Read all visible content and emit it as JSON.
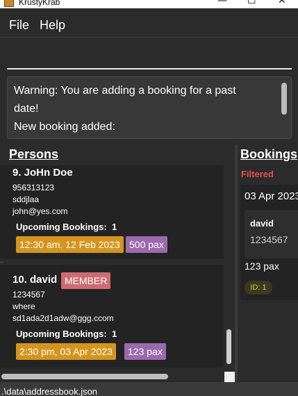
{
  "window": {
    "title": "KrustyKrab",
    "minimize_glyph": "—",
    "maximize_glyph": "☐",
    "close_glyph": "✕"
  },
  "menu": {
    "file": "File",
    "help": "Help"
  },
  "command": {
    "value": ""
  },
  "result": {
    "line1": "Warning: You are adding a booking for a past",
    "line2": "date!",
    "line3": "New booking added:"
  },
  "persons": {
    "heading": "Persons",
    "list": [
      {
        "name": "9. JoHn Doe",
        "phone": "956313123",
        "address": "sddjlaa",
        "email": "john@yes.com",
        "upcoming_label": "Upcoming Bookings:",
        "upcoming_count": "1",
        "booking_time": "12:30 am, 12 Feb 2023",
        "booking_pax": "500 pax"
      },
      {
        "name": "10. david",
        "tag": "MEMBER",
        "phone": "1234567",
        "address": "where",
        "email": "sd1ada2d1adw@ggg.ccom",
        "upcoming_label": "Upcoming Bookings:",
        "upcoming_count": "1",
        "booking_time": "2:30 pm, 03 Apr 2023",
        "booking_pax": "123 pax"
      }
    ]
  },
  "bookings": {
    "heading": "Bookings",
    "filter_label": "Filtered",
    "card": {
      "date": "03 Apr 2023",
      "customer_name": "david",
      "customer_phone": "1234567",
      "pax": "123 pax",
      "id": "ID: 1"
    }
  },
  "status": {
    "path": ".\\data\\addressbook.json"
  },
  "colors": {
    "accent_orange": "#d4951f",
    "accent_purple": "#9a6aab",
    "member_tag": "#cd6b73",
    "filtered": "#e05050",
    "id_badge": "#e0c43a"
  }
}
